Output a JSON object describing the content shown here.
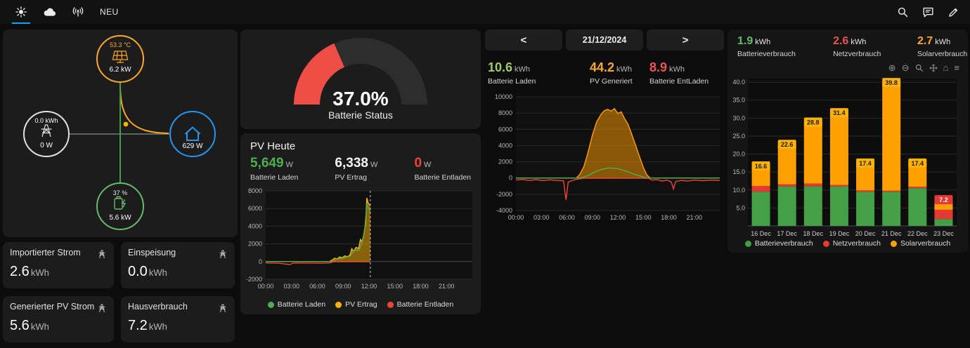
{
  "topbar": {
    "icons": [
      "sun-icon",
      "cloud-icon",
      "signal-icon"
    ],
    "neu_label": "NEU",
    "actions": [
      "search-icon",
      "chat-icon",
      "edit-icon"
    ]
  },
  "flow": {
    "colors": {
      "solar": "#ffa726",
      "grid": "#e0e0e0",
      "home": "#2196f3",
      "battery": "#66bb6a"
    },
    "solar": {
      "temperature": "53.3 °C",
      "power": "6.2 kW"
    },
    "grid": {
      "energy_today": "0.0 kWh",
      "power": "0 W"
    },
    "home": {
      "power": "629 W"
    },
    "battery": {
      "soc": "37 %",
      "power": "5.6 kW"
    }
  },
  "stat_cards": [
    {
      "title": "Importierter Strom",
      "value": "2.6",
      "unit": "kWh"
    },
    {
      "title": "Einspeisung",
      "value": "0.0",
      "unit": "kWh"
    },
    {
      "title": "Generierter PV Strom",
      "value": "5.6",
      "unit": "kWh"
    },
    {
      "title": "Hausverbrauch",
      "value": "7.2",
      "unit": "kWh"
    }
  ],
  "gauge": {
    "percent": 37,
    "value_label": "37.0%",
    "caption": "Batterie Status",
    "color": "#ef4e46"
  },
  "pv_today": {
    "title": "PV Heute",
    "stats": [
      {
        "value": "5,649",
        "unit": "W",
        "label": "Batterie Laden",
        "color": "#4caf50"
      },
      {
        "value": "6,338",
        "unit": "W",
        "label": "PV Ertrag",
        "color": "#f5f5f5"
      },
      {
        "value": "0",
        "unit": "W",
        "label": "Batterie Entladen",
        "color": "#f44336"
      }
    ],
    "legend": [
      {
        "label": "Batterie Laden",
        "color": "#4caf50"
      },
      {
        "label": "PV Ertrag",
        "color": "#ffb300"
      },
      {
        "label": "Batterie Entladen",
        "color": "#f44336"
      }
    ]
  },
  "day_panel": {
    "prev": "<",
    "date": "21/12/2024",
    "next": ">",
    "stats": [
      {
        "value": "10.6",
        "unit": "kWh",
        "label": "Batterie Laden",
        "color": "#9ccc65"
      },
      {
        "value": "44.2",
        "unit": "kWh",
        "label": "PV Generiert",
        "color": "#ffa726"
      },
      {
        "value": "8.9",
        "unit": "kWh",
        "label": "Batterie EntLaden",
        "color": "#ef5350"
      }
    ]
  },
  "week_panel": {
    "stats": [
      {
        "value": "1.9",
        "unit": "kWh",
        "label": "Batterieverbrauch",
        "color": "#66bb6a"
      },
      {
        "value": "2.6",
        "unit": "kWh",
        "label": "Netzverbrauch",
        "color": "#ef5350"
      },
      {
        "value": "2.7",
        "unit": "kWh",
        "label": "Solarverbrauch",
        "color": "#ffa726"
      }
    ],
    "toolbar": [
      "zoom-in",
      "zoom-out",
      "autoscale",
      "pan",
      "home",
      "menu"
    ],
    "legend": [
      {
        "label": "Batterieverbrauch",
        "color": "#43a047"
      },
      {
        "label": "Netzverbrauch",
        "color": "#e53935"
      },
      {
        "label": "Solarverbrauch",
        "color": "#ffa000"
      }
    ]
  },
  "chart_data": [
    {
      "id": "pv-today-chart",
      "type": "area",
      "title": "PV Heute",
      "xlim": [
        0,
        24
      ],
      "ylim": [
        -2000,
        8000
      ],
      "x_ticks": [
        [
          0,
          "00:00"
        ],
        [
          3,
          "03:00"
        ],
        [
          6,
          "06:00"
        ],
        [
          9,
          "09:00"
        ],
        [
          12,
          "12:00"
        ],
        [
          15,
          "15:00"
        ],
        [
          18,
          "18:00"
        ],
        [
          21,
          "21:00"
        ]
      ],
      "y_ticks": [
        8000,
        6000,
        4000,
        2000,
        0,
        -2000
      ],
      "now": 12.15,
      "series": [
        {
          "name": "PV Ertrag",
          "color": "#ffb300",
          "fill": true,
          "points": [
            [
              0,
              0
            ],
            [
              7.4,
              0
            ],
            [
              7.7,
              150
            ],
            [
              8.0,
              380
            ],
            [
              8.3,
              300
            ],
            [
              8.6,
              520
            ],
            [
              8.9,
              430
            ],
            [
              9.2,
              640
            ],
            [
              9.5,
              520
            ],
            [
              9.8,
              780
            ],
            [
              10.0,
              1450
            ],
            [
              10.2,
              1150
            ],
            [
              10.5,
              1600
            ],
            [
              10.8,
              1500
            ],
            [
              11.0,
              2500
            ],
            [
              11.2,
              2250
            ],
            [
              11.4,
              3100
            ],
            [
              11.6,
              4300
            ],
            [
              11.75,
              7200
            ],
            [
              11.9,
              6600
            ],
            [
              12.15,
              6338
            ]
          ]
        },
        {
          "name": "Batterie Laden",
          "color": "#4caf50",
          "fill": false,
          "points": [
            [
              0,
              0
            ],
            [
              7.8,
              0
            ],
            [
              8.2,
              260
            ],
            [
              9.0,
              380
            ],
            [
              9.8,
              620
            ],
            [
              10.3,
              1300
            ],
            [
              10.8,
              1250
            ],
            [
              11.2,
              2100
            ],
            [
              11.5,
              3700
            ],
            [
              11.75,
              6400
            ],
            [
              12.15,
              5649
            ]
          ]
        },
        {
          "name": "Batterie Entladen",
          "color": "#f44336",
          "fill": false,
          "points": [
            [
              0,
              -150
            ],
            [
              1.5,
              -180
            ],
            [
              2.8,
              -340
            ],
            [
              3.2,
              -160
            ],
            [
              5.0,
              -170
            ],
            [
              6.5,
              -180
            ],
            [
              7.5,
              -150
            ],
            [
              7.8,
              -20
            ],
            [
              12.15,
              -20
            ]
          ]
        }
      ]
    },
    {
      "id": "day-chart",
      "type": "area",
      "title": "21/12/2024",
      "xlim": [
        0,
        24
      ],
      "ylim": [
        -4000,
        10000
      ],
      "x_ticks": [
        [
          0,
          "00:00"
        ],
        [
          3,
          "03:00"
        ],
        [
          6,
          "06:00"
        ],
        [
          9,
          "09:00"
        ],
        [
          12,
          "12:00"
        ],
        [
          15,
          "15:00"
        ],
        [
          18,
          "18:00"
        ],
        [
          21,
          "21:00"
        ]
      ],
      "y_ticks": [
        10000,
        8000,
        6000,
        4000,
        2000,
        0,
        -2000,
        -4000
      ],
      "series": [
        {
          "name": "PV Generiert",
          "color": "#ffa000",
          "fill": true,
          "points": [
            [
              0,
              0
            ],
            [
              7.1,
              0
            ],
            [
              7.5,
              400
            ],
            [
              8.0,
              1400
            ],
            [
              8.5,
              3200
            ],
            [
              9.0,
              5300
            ],
            [
              9.5,
              6900
            ],
            [
              10.0,
              7800
            ],
            [
              10.4,
              8300
            ],
            [
              10.8,
              8450
            ],
            [
              11.2,
              8250
            ],
            [
              11.6,
              8550
            ],
            [
              12.0,
              7950
            ],
            [
              12.4,
              8150
            ],
            [
              12.8,
              7300
            ],
            [
              13.2,
              6600
            ],
            [
              13.6,
              5500
            ],
            [
              14.0,
              4300
            ],
            [
              14.5,
              2800
            ],
            [
              15.0,
              1300
            ],
            [
              15.4,
              400
            ],
            [
              15.8,
              0
            ],
            [
              24,
              0
            ]
          ]
        },
        {
          "name": "Batterie Laden",
          "color": "#4caf50",
          "fill": false,
          "points": [
            [
              0,
              0
            ],
            [
              7.6,
              0
            ],
            [
              8.4,
              250
            ],
            [
              9.2,
              700
            ],
            [
              10.0,
              1050
            ],
            [
              11.0,
              1250
            ],
            [
              12.0,
              1150
            ],
            [
              13.0,
              850
            ],
            [
              14.0,
              430
            ],
            [
              15.0,
              120
            ],
            [
              15.5,
              0
            ],
            [
              24,
              0
            ]
          ]
        },
        {
          "name": "Batterie Entladen",
          "color": "#f44336",
          "fill": false,
          "points": [
            [
              0,
              -250
            ],
            [
              0.8,
              -180
            ],
            [
              1.6,
              -300
            ],
            [
              2.4,
              -200
            ],
            [
              3.2,
              -320
            ],
            [
              4.0,
              -220
            ],
            [
              4.8,
              -300
            ],
            [
              5.6,
              -350
            ],
            [
              5.9,
              -2700
            ],
            [
              6.15,
              -500
            ],
            [
              6.8,
              -250
            ],
            [
              7.4,
              -120
            ],
            [
              8.0,
              -30
            ],
            [
              15.6,
              -30
            ],
            [
              16.0,
              -260
            ],
            [
              16.6,
              -200
            ],
            [
              17.2,
              -380
            ],
            [
              17.8,
              -260
            ],
            [
              18.3,
              -500
            ],
            [
              18.55,
              -1350
            ],
            [
              18.8,
              -420
            ],
            [
              19.5,
              -300
            ],
            [
              20.2,
              -380
            ],
            [
              21.0,
              -260
            ],
            [
              22.0,
              -330
            ],
            [
              23.0,
              -260
            ],
            [
              24,
              -300
            ]
          ]
        }
      ]
    },
    {
      "id": "week-chart",
      "type": "stacked-bar",
      "categories": [
        "16 Dec",
        "17 Dec",
        "18 Dec",
        "19 Dec",
        "20 Dec",
        "21 Dec",
        "22 Dec",
        "23 Dec"
      ],
      "ylim": [
        0,
        41
      ],
      "y_ticks": [
        5,
        10,
        15,
        20,
        25,
        30,
        35,
        40
      ],
      "series": [
        {
          "name": "Batterieverbrauch",
          "color": "#43a047",
          "values": [
            9.5,
            11.0,
            11.0,
            11.0,
            9.5,
            9.5,
            10.5,
            1.9
          ]
        },
        {
          "name": "Netzverbrauch",
          "color": "#e53935",
          "values": [
            1.6,
            0.6,
            0.8,
            0.4,
            0.4,
            0.3,
            0.4,
            2.6
          ]
        },
        {
          "name": "Solarverbrauch",
          "color": "#ffa000",
          "values": [
            5.5,
            11.0,
            17.0,
            20.0,
            7.5,
            30.0,
            6.5,
            2.7
          ]
        }
      ],
      "totals": [
        16.6,
        22.6,
        28.8,
        31.4,
        17.4,
        39.8,
        17.4,
        7.2
      ],
      "total_badge_colors": [
        "#ffb300",
        "#ffb300",
        "#ffb300",
        "#ffb300",
        "#ffb300",
        "#ffb300",
        "#ffb300",
        "#e53935"
      ],
      "legend_position": "bottom"
    }
  ]
}
